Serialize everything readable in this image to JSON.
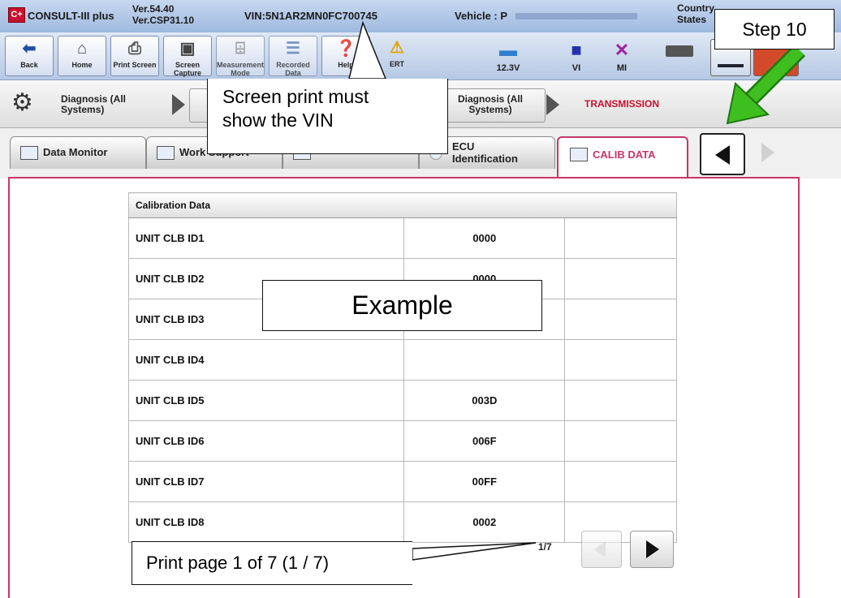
{
  "titlebar": {
    "app_name": "CONSULT-III plus",
    "logo": "C+",
    "version1": "Ver.54.40",
    "version2": "Ver.CSP31.10",
    "vin_label": "VIN:5N1AR2MN0FC700745",
    "vehicle_label": "Vehicle : P",
    "country_line1": "Country",
    "country_line2": "States"
  },
  "toolbar": {
    "buttons": [
      {
        "label": "Back",
        "icon": "back-arrow-icon"
      },
      {
        "label": "Home",
        "icon": "home-icon"
      },
      {
        "label": "Print Screen",
        "icon": "printer-icon"
      },
      {
        "label": "Screen Capture",
        "icon": "camera-icon"
      },
      {
        "label": "Measurement Mode",
        "icon": "measurement-icon"
      },
      {
        "label": "Recorded Data",
        "icon": "recorded-data-icon"
      },
      {
        "label": "Help",
        "icon": "help-icon"
      },
      {
        "label": "ERT",
        "icon": "warning-icon"
      }
    ],
    "status": [
      {
        "label": "12.3V",
        "icon": "car-battery-icon"
      },
      {
        "label": "VI",
        "icon": "vi-icon"
      },
      {
        "label": "MI",
        "icon": "mi-x-icon"
      }
    ]
  },
  "breadcrumb": {
    "items": [
      "Diagnosis (All Systems)",
      "Diagnosis (All Systems)",
      "TRANSMISSION"
    ]
  },
  "tabs": [
    {
      "label": "Data Monitor"
    },
    {
      "label": "Work Support"
    },
    {
      "label": ""
    },
    {
      "label": "ECU Identification"
    },
    {
      "label": "CALIB DATA",
      "active": true
    }
  ],
  "table": {
    "header": "Calibration Data",
    "rows": [
      {
        "name": "UNIT CLB ID1",
        "value": "0000"
      },
      {
        "name": "UNIT CLB ID2",
        "value": "0000"
      },
      {
        "name": "UNIT CLB ID3",
        "value": ""
      },
      {
        "name": "UNIT CLB ID4",
        "value": ""
      },
      {
        "name": "UNIT CLB ID5",
        "value": "003D"
      },
      {
        "name": "UNIT CLB ID6",
        "value": "006F"
      },
      {
        "name": "UNIT CLB ID7",
        "value": "00FF"
      },
      {
        "name": "UNIT CLB ID8",
        "value": "0002"
      }
    ]
  },
  "pagination": {
    "page_indicator": "1/7"
  },
  "annotations": {
    "step": "Step 10",
    "vin_note_line1": "Screen print must",
    "vin_note_line2": "show the VIN",
    "example": "Example",
    "print_note": "Print page 1 of 7 (1 / 7)"
  },
  "colors": {
    "accent_tab": "#c8366a",
    "transmission_text": "#c8102e",
    "arrow_green": "#3fbf1f"
  }
}
